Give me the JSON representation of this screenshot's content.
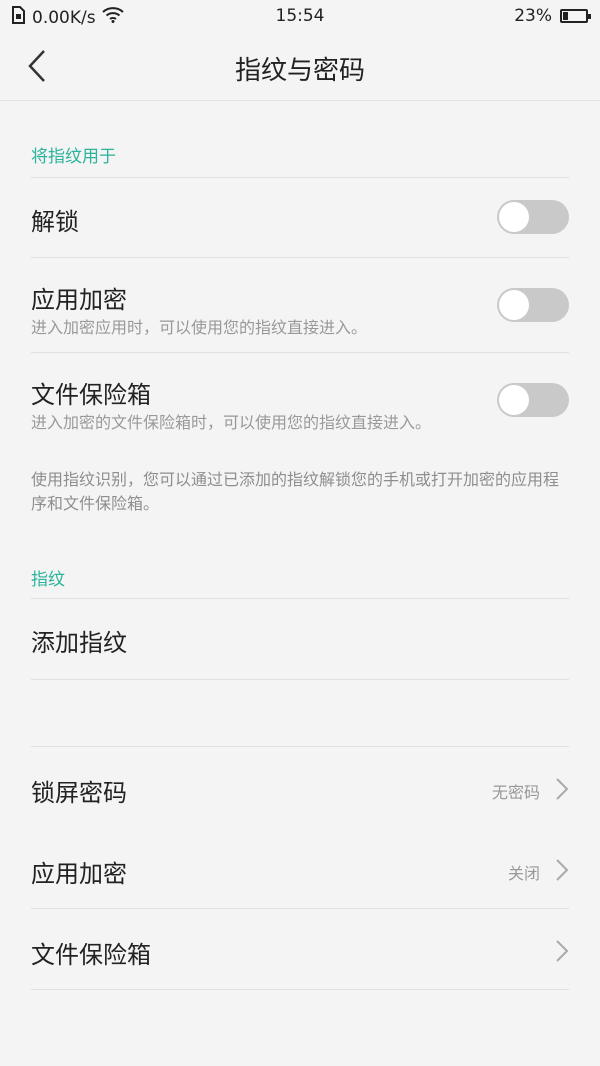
{
  "status_bar": {
    "network_speed": "0.00K/s",
    "time": "15:54",
    "battery": "23%",
    "battery_level": 0.23
  },
  "header": {
    "title": "指纹与密码"
  },
  "fingerprint_usage": {
    "section_label": "将指纹用于",
    "items": [
      {
        "label": "解锁",
        "subtitle": "",
        "enabled": false
      },
      {
        "label": "应用加密",
        "subtitle": "进入加密应用时，可以使用您的指纹直接进入。",
        "enabled": false
      },
      {
        "label": "文件保险箱",
        "subtitle": "进入加密的文件保险箱时，可以使用您的指纹直接进入。",
        "enabled": false
      }
    ],
    "description": "使用指纹识别，您可以通过已添加的指纹解锁您的手机或打开加密的应用程序和文件保险箱。"
  },
  "fingerprints": {
    "section_label": "指纹",
    "add_label": "添加指纹"
  },
  "passwords": {
    "items": [
      {
        "label": "锁屏密码",
        "value": "无密码"
      },
      {
        "label": "应用加密",
        "value": "关闭"
      },
      {
        "label": "文件保险箱",
        "value": ""
      }
    ]
  },
  "colors": {
    "accent": "#2bb39b",
    "toggle_off": "#c9c9c9",
    "background": "#f4f4f4"
  }
}
